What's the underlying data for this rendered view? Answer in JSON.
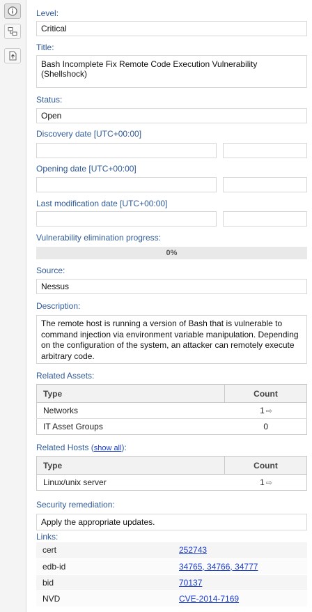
{
  "toolbar": {
    "info_icon": "info-icon",
    "relations_icon": "relations-icon",
    "export_icon": "export-icon"
  },
  "level": {
    "label": "Level:",
    "value": "Critical"
  },
  "title": {
    "label": "Title:",
    "value": "Bash Incomplete Fix Remote Code Execution Vulnerability (Shellshock)"
  },
  "status": {
    "label": "Status:",
    "value": "Open"
  },
  "discovery_date": {
    "label": "Discovery date [UTC+00:00]",
    "date": "",
    "time": ""
  },
  "opening_date": {
    "label": "Opening date [UTC+00:00]",
    "date": "",
    "time": ""
  },
  "last_modification_date": {
    "label": "Last modification date [UTC+00:00]",
    "date": "",
    "time": ""
  },
  "progress": {
    "label": "Vulnerability elimination progress:",
    "text": "0%",
    "value": 0
  },
  "source": {
    "label": "Source:",
    "value": "Nessus"
  },
  "description": {
    "label": "Description:",
    "value": "The remote host is running a version of Bash that is vulnerable to command injection via environment variable manipulation. Depending on the configuration of the system, an attacker can remotely execute arbitrary code."
  },
  "related_assets": {
    "label": "Related Assets:",
    "columns": [
      "Type",
      "Count"
    ],
    "rows": [
      {
        "type": "Networks",
        "count": "1",
        "has_arrow": true
      },
      {
        "type": "IT Asset Groups",
        "count": "0",
        "has_arrow": false
      }
    ]
  },
  "related_hosts": {
    "label": "Related Hosts (",
    "show_all": "show all",
    "label_suffix": "):",
    "columns": [
      "Type",
      "Count"
    ],
    "rows": [
      {
        "type": "Linux/unix server",
        "count": "1",
        "has_arrow": true
      }
    ]
  },
  "remediation": {
    "label": "Security remediation:",
    "value": "Apply the appropriate updates."
  },
  "links": {
    "label": "Links:",
    "rows": [
      {
        "key": "cert",
        "value": "252743"
      },
      {
        "key": "edb-id",
        "value": "34765, 34766, 34777"
      },
      {
        "key": "bid",
        "value": "70137"
      },
      {
        "key": "NVD",
        "value": "CVE-2014-7169"
      }
    ]
  },
  "arrow_glyph": "⇨"
}
